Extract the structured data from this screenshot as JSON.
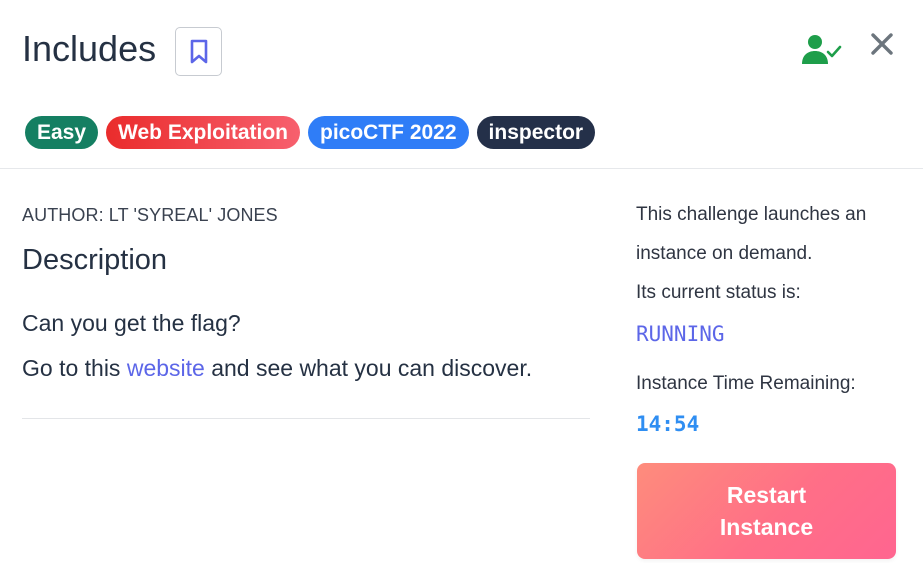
{
  "header": {
    "title": "Includes",
    "tags": [
      {
        "label": "Easy",
        "color": "#157f62"
      },
      {
        "label": "Web Exploitation",
        "color": "#ef3f49"
      },
      {
        "label": "picoCTF 2022",
        "color": "#2f7df7"
      },
      {
        "label": "inspector",
        "color": "#243049"
      }
    ]
  },
  "icons": {
    "bookmark": "bookmark-icon",
    "user_check": "user-check-icon",
    "close": "close-icon"
  },
  "main": {
    "author": "AUTHOR: LT 'SYREAL' JONES",
    "description_heading": "Description",
    "description_line1": "Can you get the flag?",
    "description_line2_before": "Go to this ",
    "description_link": "website",
    "description_line2_after": " and see what you can discover."
  },
  "instance": {
    "launch_text_1": "This challenge launches an",
    "launch_text_2": "instance on demand.",
    "status_label": "Its current status is:",
    "status_value": "RUNNING",
    "time_label": "Instance Time Remaining:",
    "time_value": "14:54",
    "restart_line1": "Restart",
    "restart_line2": "Instance"
  },
  "colors": {
    "accent": "#5c66e8",
    "timer": "#2f8ef2",
    "solved": "#1e9e4a",
    "restart_start": "#fe8c7c",
    "restart_end": "#ff6590"
  }
}
